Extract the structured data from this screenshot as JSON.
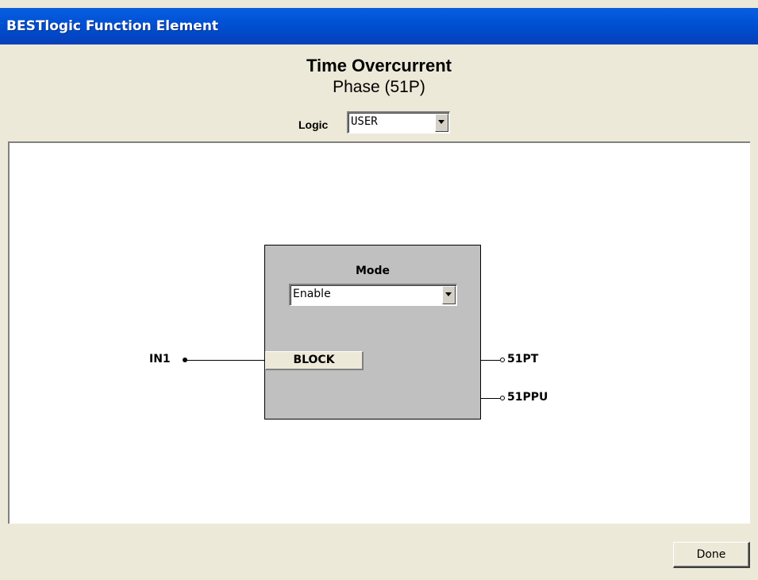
{
  "window": {
    "title": "BESTlogic Function Element"
  },
  "header": {
    "title": "Time Overcurrent",
    "subtitle": "Phase (51P)",
    "logic_label": "Logic",
    "logic_value": "USER"
  },
  "block": {
    "mode_label": "Mode",
    "mode_value": "Enable",
    "block_label": "BLOCK"
  },
  "signals": {
    "input": "IN1",
    "output_trip": "51PT",
    "output_pickup": "51PPU"
  },
  "footer": {
    "done_label": "Done"
  }
}
